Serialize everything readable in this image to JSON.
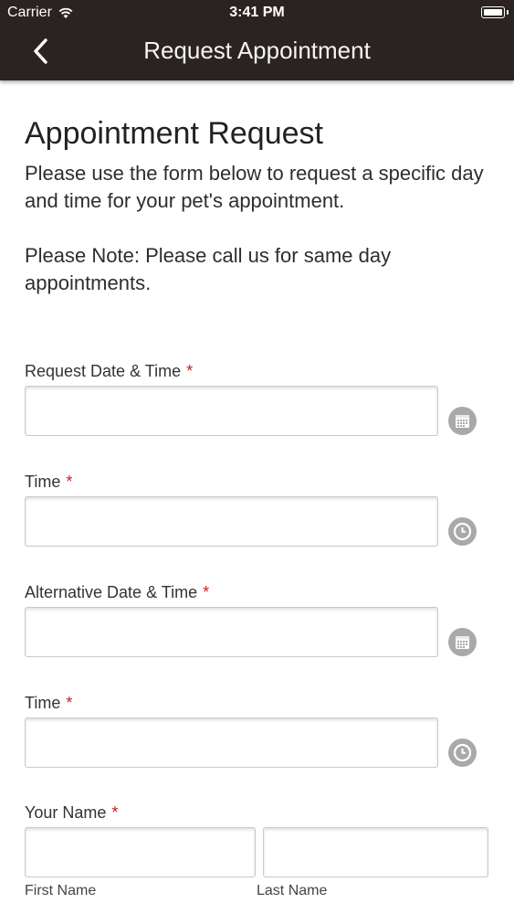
{
  "status_bar": {
    "carrier": "Carrier",
    "time": "3:41 PM"
  },
  "nav": {
    "title": "Request Appointment"
  },
  "content": {
    "heading": "Appointment Request",
    "intro": "Please use the form below to request a specific day and time for your pet's appointment.",
    "note": "Please Note: Please call us for same day appointments."
  },
  "form": {
    "required_mark": "*",
    "request_date": {
      "label": "Request Date & Time",
      "value": "",
      "icon": "calendar-icon"
    },
    "request_time": {
      "label": "Time",
      "value": "",
      "icon": "clock-icon"
    },
    "alternative_date": {
      "label": "Alternative Date & Time",
      "value": "",
      "icon": "calendar-icon"
    },
    "alternative_time": {
      "label": "Time",
      "value": "",
      "icon": "clock-icon"
    },
    "your_name": {
      "label": "Your Name",
      "first_name_sublabel": "First Name",
      "last_name_sublabel": "Last Name",
      "first_name_value": "",
      "last_name_value": ""
    }
  },
  "colors": {
    "header_bg": "#2a2322",
    "required": "#cc1f1f",
    "icon_bg": "#a9a9a9"
  }
}
